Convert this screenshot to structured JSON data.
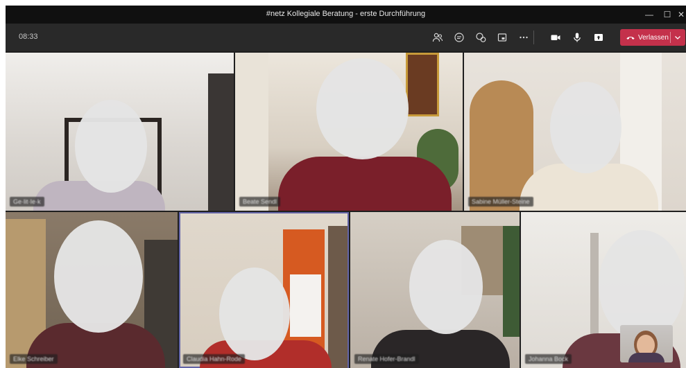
{
  "window": {
    "title": "#netz Kollegiale Beratung - erste Durchführung",
    "controls": {
      "minimize": "—",
      "maximize": "☐",
      "close": "✕"
    }
  },
  "toolbar": {
    "time": "08:33",
    "icons": [
      "participants-icon",
      "chat-icon",
      "reactions-icon",
      "share-tray-icon",
      "more-icon",
      "camera-icon",
      "microphone-icon",
      "share-icon"
    ],
    "leave_label": "Verlassen",
    "leave_color": "#c4314b"
  },
  "participants": [
    {
      "name": "Ge·lit·Ie·k"
    },
    {
      "name": "Beate Sendl"
    },
    {
      "name": "Sabine Müller-Steine"
    },
    {
      "name": "Elke Schreiber"
    },
    {
      "name": "Claudia Hahn-Rode"
    },
    {
      "name": "Renate Hofer-Brandl"
    },
    {
      "name": "Johanna Bock"
    }
  ],
  "colors": {
    "active_speaker_outline": "#6264a7",
    "window_bg": "#1f1f1f",
    "toolbar_bg": "#292929"
  }
}
